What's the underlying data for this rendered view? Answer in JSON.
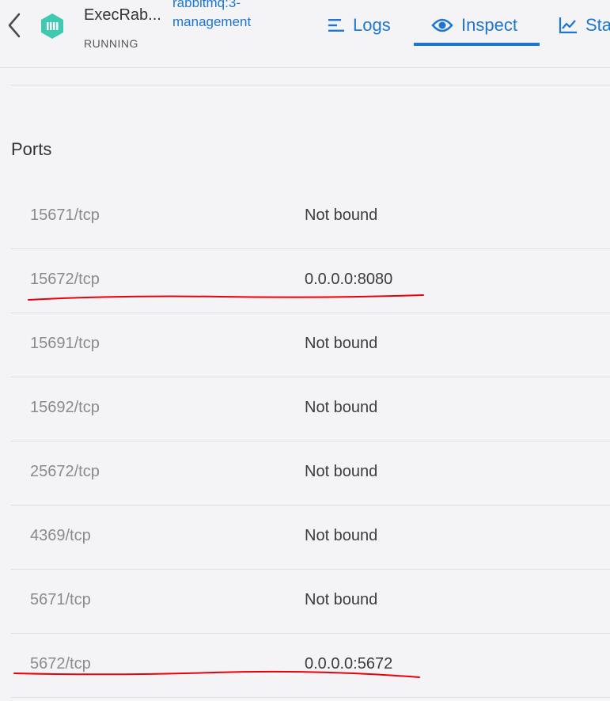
{
  "header": {
    "container_name": "ExecRab...",
    "status": "RUNNING",
    "image_line1": "rabbitmq:3-",
    "image_line2": "management"
  },
  "tabs": [
    {
      "label": "Logs",
      "icon": "logs-icon"
    },
    {
      "label": "Inspect",
      "icon": "eye-icon",
      "active": true
    },
    {
      "label": "Sta",
      "icon": "stats-chart-icon"
    }
  ],
  "ports_section": {
    "title": "Ports",
    "rows": [
      {
        "port": "15671/tcp",
        "binding": "Not bound"
      },
      {
        "port": "15672/tcp",
        "binding": "0.0.0.0:8080",
        "highlighted": true
      },
      {
        "port": "15691/tcp",
        "binding": "Not bound"
      },
      {
        "port": "15692/tcp",
        "binding": "Not bound"
      },
      {
        "port": "25672/tcp",
        "binding": "Not bound"
      },
      {
        "port": "4369/tcp",
        "binding": "Not bound"
      },
      {
        "port": "5671/tcp",
        "binding": "Not bound"
      },
      {
        "port": "5672/tcp",
        "binding": "0.0.0.0:5672",
        "highlighted": true
      }
    ]
  },
  "colors": {
    "accent": "#1d77d2",
    "container_icon": "#3ec9b1",
    "annotation": "#e8000b"
  }
}
